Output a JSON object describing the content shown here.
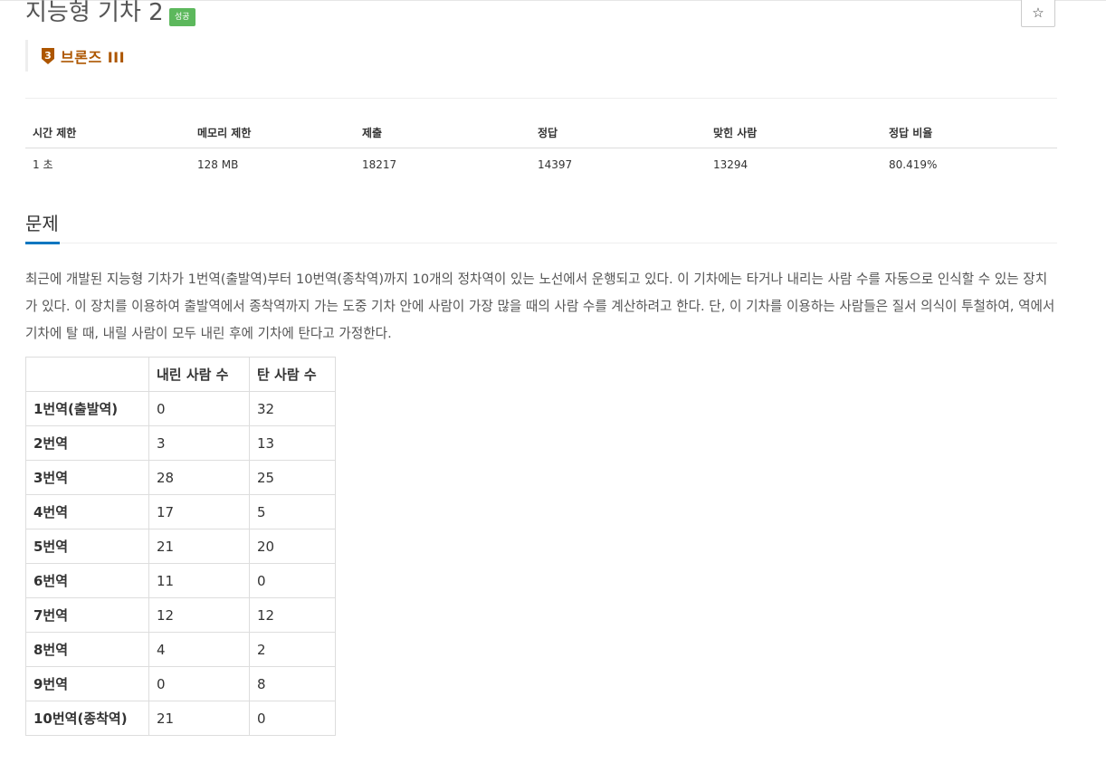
{
  "problem": {
    "title": "지능형 기차 2",
    "status_badge": "성공",
    "star_icon": "☆",
    "tier": {
      "number": "3",
      "label": "브론즈 III",
      "color": "#ad5600"
    }
  },
  "stats": {
    "headers": [
      "시간 제한",
      "메모리 제한",
      "제출",
      "정답",
      "맞힌 사람",
      "정답 비율"
    ],
    "values": [
      "1 초",
      "128 MB",
      "18217",
      "14397",
      "13294",
      "80.419%"
    ]
  },
  "section": {
    "title": "문제"
  },
  "description": "최근에 개발된 지능형 기차가 1번역(출발역)부터 10번역(종착역)까지 10개의 정차역이 있는 노선에서 운행되고 있다. 이 기차에는 타거나 내리는 사람 수를 자동으로 인식할 수 있는 장치가 있다. 이 장치를 이용하여 출발역에서 종착역까지 가는 도중 기차 안에 사람이 가장 많을 때의 사람 수를 계산하려고 한다. 단, 이 기차를 이용하는 사람들은 질서 의식이 투철하여, 역에서 기차에 탈 때, 내릴 사람이 모두 내린 후에 기차에 탄다고 가정한다.",
  "table": {
    "headers": [
      "",
      "내린 사람 수",
      "탄 사람 수"
    ],
    "rows": [
      [
        "1번역(출발역)",
        "0",
        "32"
      ],
      [
        "2번역",
        "3",
        "13"
      ],
      [
        "3번역",
        "28",
        "25"
      ],
      [
        "4번역",
        "17",
        "5"
      ],
      [
        "5번역",
        "21",
        "20"
      ],
      [
        "6번역",
        "11",
        "0"
      ],
      [
        "7번역",
        "12",
        "12"
      ],
      [
        "8번역",
        "4",
        "2"
      ],
      [
        "9번역",
        "0",
        "8"
      ],
      [
        "10번역(종착역)",
        "21",
        "0"
      ]
    ]
  },
  "colors": {
    "success_badge": "#5cb85c",
    "bronze": "#ad5600",
    "section_accent": "#0076c0"
  }
}
